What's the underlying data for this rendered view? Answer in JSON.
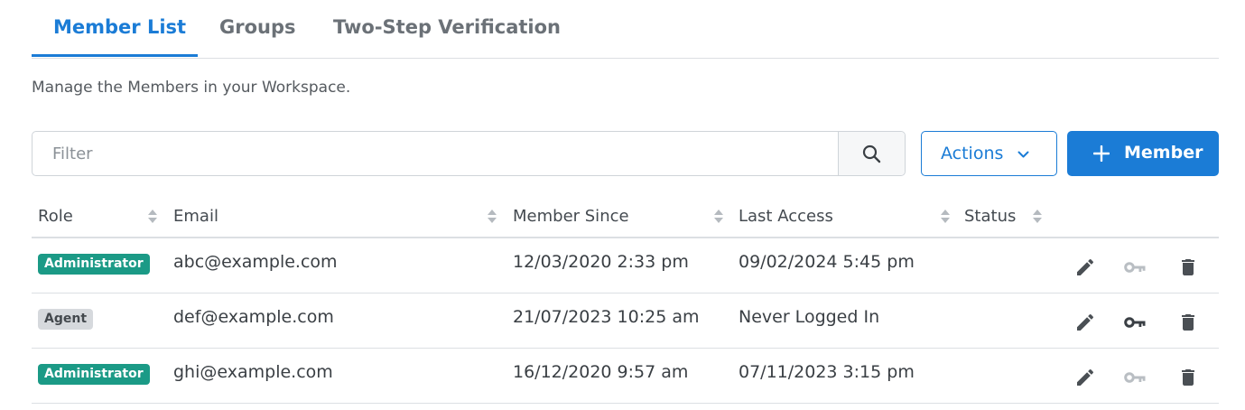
{
  "tabs": [
    {
      "label": "Member List"
    },
    {
      "label": "Groups"
    },
    {
      "label": "Two-Step Verification"
    }
  ],
  "description": "Manage the Members in your Workspace.",
  "filter": {
    "placeholder": "Filter",
    "value": ""
  },
  "actions_label": "Actions",
  "add_member_label": "Member",
  "columns": {
    "role": "Role",
    "email": "Email",
    "member_since": "Member Since",
    "last_access": "Last Access",
    "status": "Status"
  },
  "members": [
    {
      "role": "Administrator",
      "email": "abc@example.com",
      "member_since": "12/03/2020 2:33 pm",
      "last_access": "09/02/2024 5:45 pm",
      "status": "",
      "key_enabled": false
    },
    {
      "role": "Agent",
      "email": "def@example.com",
      "member_since": "21/07/2023 10:25 am",
      "last_access": "Never Logged In",
      "status": "",
      "key_enabled": true
    },
    {
      "role": "Administrator",
      "email": "ghi@example.com",
      "member_since": "16/12/2020 9:57 am",
      "last_access": "07/11/2023 3:15 pm",
      "status": "",
      "key_enabled": false
    }
  ],
  "icons": {
    "search": "search-icon",
    "actions_dropdown": "chevron-down-icon",
    "add": "plus-icon",
    "row_actions": [
      "pencil-icon",
      "key-icon",
      "trash-icon"
    ]
  },
  "colors": {
    "accent": "#1b7cd6",
    "admin_badge": "#1b9a86",
    "agent_badge": "#d6d9dd",
    "icon_active": "#4a4f54",
    "icon_disabled": "#b9bec3"
  }
}
